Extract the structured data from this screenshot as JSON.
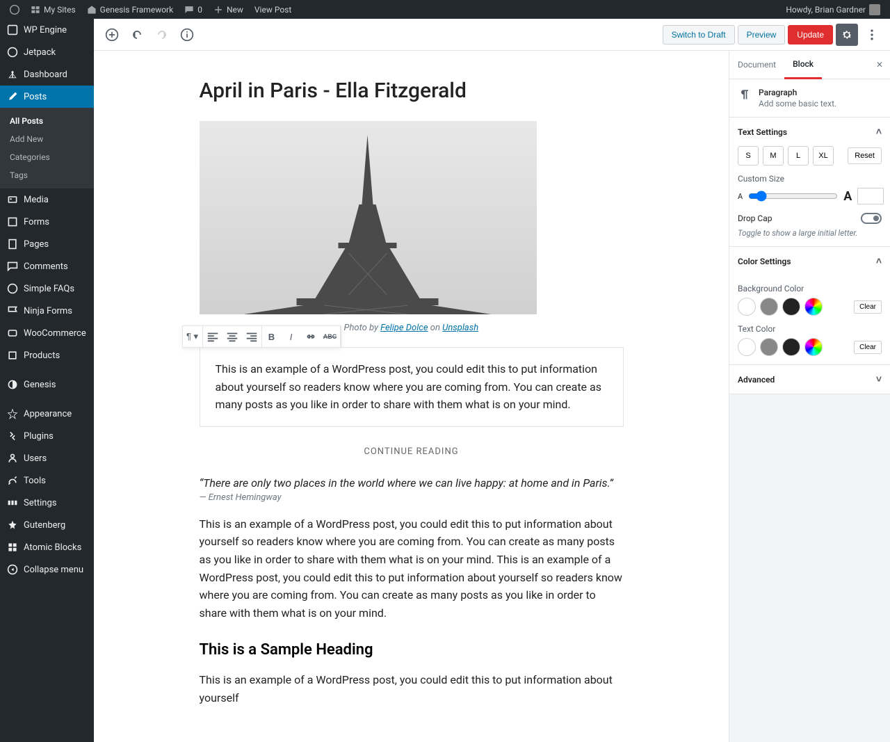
{
  "adminbar": {
    "my_sites": "My Sites",
    "site_title": "Genesis Framework",
    "comments": "0",
    "new": "New",
    "view_post": "View Post",
    "howdy": "Howdy, Brian Gardner"
  },
  "sidebar": {
    "items": [
      {
        "label": "WP Engine"
      },
      {
        "label": "Jetpack"
      },
      {
        "label": "Dashboard"
      },
      {
        "label": "Posts",
        "active": true
      },
      {
        "label": "Media"
      },
      {
        "label": "Forms"
      },
      {
        "label": "Pages"
      },
      {
        "label": "Comments"
      },
      {
        "label": "Simple FAQs"
      },
      {
        "label": "Ninja Forms"
      },
      {
        "label": "WooCommerce"
      },
      {
        "label": "Products"
      },
      {
        "label": "Genesis"
      },
      {
        "label": "Appearance"
      },
      {
        "label": "Plugins"
      },
      {
        "label": "Users"
      },
      {
        "label": "Tools"
      },
      {
        "label": "Settings"
      },
      {
        "label": "Gutenberg"
      },
      {
        "label": "Atomic Blocks"
      },
      {
        "label": "Collapse menu"
      }
    ],
    "posts_sub": [
      {
        "label": "All Posts",
        "active": true
      },
      {
        "label": "Add New"
      },
      {
        "label": "Categories"
      },
      {
        "label": "Tags"
      }
    ]
  },
  "header_buttons": {
    "switch_draft": "Switch to Draft",
    "preview": "Preview",
    "update": "Update"
  },
  "post": {
    "title": "April in Paris - Ella Fitzgerald",
    "caption_prefix": "Photo by ",
    "caption_author": "Felipe Dolce",
    "caption_on": " on ",
    "caption_source": "Unsplash",
    "para1": "This is an example of a WordPress post, you could edit this to put information about yourself so readers know where you are coming from. You can create as many posts as you like in order to share with them what is on your mind.",
    "continue": "CONTINUE READING",
    "quote": "“There are only two places in the world where we can live happy: at home and in Paris.”",
    "quote_cite": "— Ernest Hemingway",
    "para2": "This is an example of a WordPress post, you could edit this to put information about yourself so readers know where you are coming from. You can create as many posts as you like in order to share with them what is on your mind. This is an example of a WordPress post, you could edit this to put information about yourself so readers know where you are coming from. You can create as many posts as you like in order to share with them what is on your mind.",
    "heading2": "This is a Sample Heading",
    "para3": "This is an example of a WordPress post, you could edit this to put information about yourself"
  },
  "inspector": {
    "tab_document": "Document",
    "tab_block": "Block",
    "block_title": "Paragraph",
    "block_desc": "Add some basic text.",
    "text_settings": "Text Settings",
    "sizes": [
      "S",
      "M",
      "L",
      "XL"
    ],
    "reset": "Reset",
    "custom_size": "Custom Size",
    "drop_cap": "Drop Cap",
    "drop_cap_help": "Toggle to show a large initial letter.",
    "color_settings": "Color Settings",
    "bg_color": "Background Color",
    "text_color": "Text Color",
    "clear": "Clear",
    "advanced": "Advanced"
  }
}
